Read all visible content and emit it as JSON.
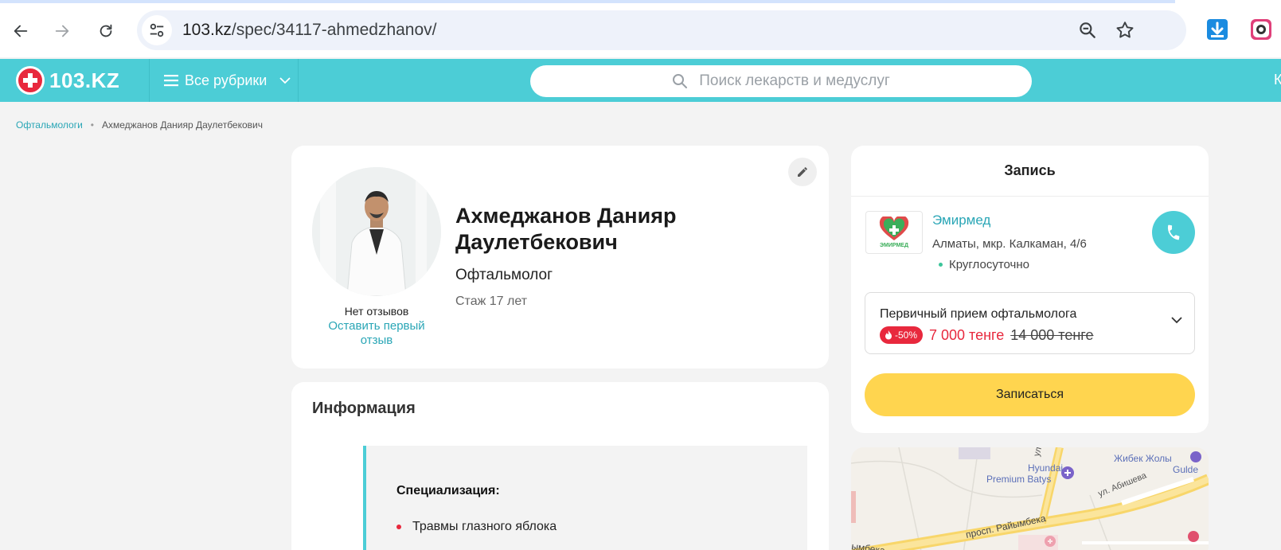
{
  "browser": {
    "url_domain": "103.kz",
    "url_path": "/spec/34117-ahmedzhanov/"
  },
  "site": {
    "logo_text": "103.KZ",
    "rubrics_label": "Все рубрики",
    "search_placeholder": "Поиск лекарств и медуслуг",
    "header_edge_text": "К"
  },
  "breadcrumb": {
    "parent": "Офтальмологи",
    "current": "Ахмеджанов Данияр Даулетбекович"
  },
  "profile": {
    "name": "Ахмеджанов Данияр Даулетбекович",
    "specialty": "Офтальмолог",
    "experience": "Стаж 17 лет",
    "reviews_none": "Нет отзывов",
    "reviews_link": "Оставить первый отзыв"
  },
  "info": {
    "title": "Информация",
    "spec_label": "Специализация:",
    "items": [
      "Травмы глазного яблока"
    ]
  },
  "booking": {
    "title": "Запись",
    "clinic": {
      "name": "Эмирмед",
      "logo_text": "ЭМИРМЕД",
      "address": "Алматы, мкр. Калкаман, 4/6",
      "hours": "Круглосуточно"
    },
    "service": {
      "name": "Первичный прием офтальмолога",
      "discount": "-50%",
      "price_new": "7 000 тенге",
      "price_old": "14 000 тенге"
    },
    "button": "Записаться"
  },
  "map": {
    "labels": {
      "hyundai": "Hyundai",
      "premium": "Premium Batys",
      "jibek": "Жибек Жолы",
      "abisheva": "ул. Абишева",
      "gulder": "Gulde",
      "raiymbek": "просп. Райымбека",
      "raiymbek2": "ымбека",
      "ul": "ул"
    }
  },
  "colors": {
    "brand_teal": "#4ccdd6",
    "brand_red": "#e8283d",
    "button_yellow": "#ffd54f"
  }
}
